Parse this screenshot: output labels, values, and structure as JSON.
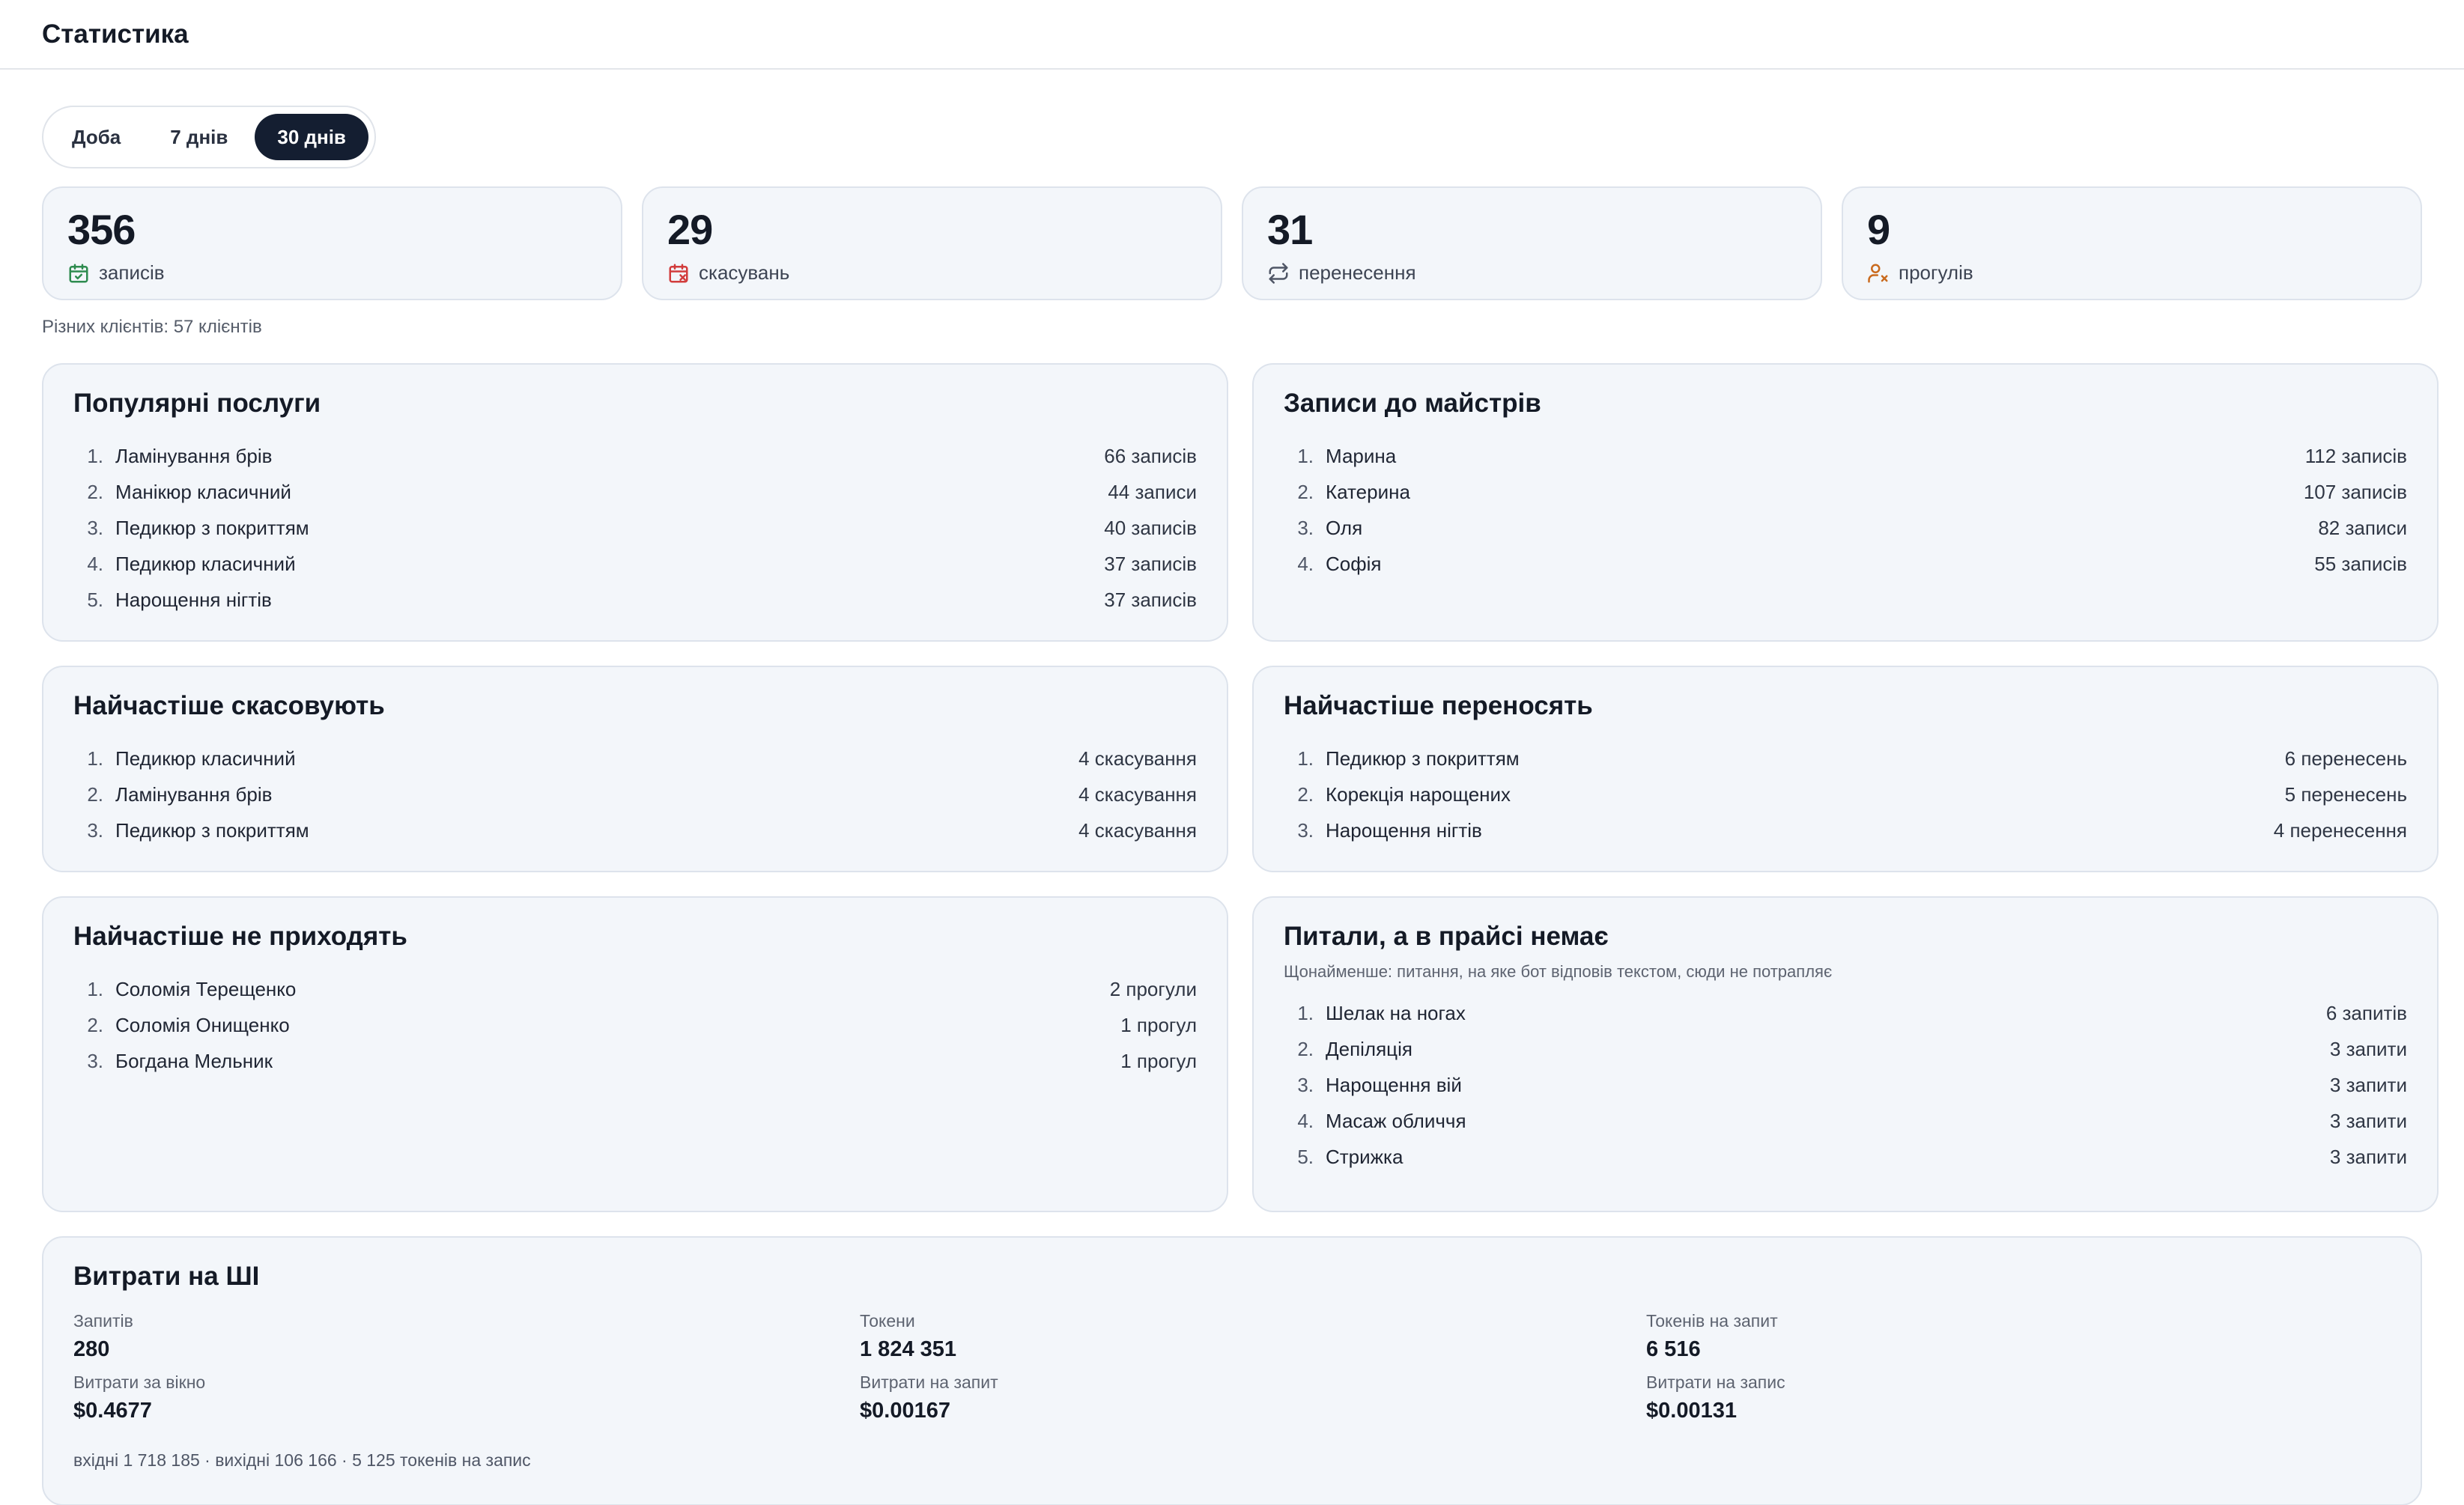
{
  "page_title": "Статистика",
  "periods": [
    {
      "label": "Доба",
      "active": false
    },
    {
      "label": "7 днів",
      "active": false
    },
    {
      "label": "30 днів",
      "active": true
    }
  ],
  "stats": [
    {
      "value": "356",
      "label": "записів",
      "icon": "calendar-check-icon",
      "color": "#2e8b4f"
    },
    {
      "value": "29",
      "label": "скасувань",
      "icon": "calendar-x-icon",
      "color": "#d23c3c"
    },
    {
      "value": "31",
      "label": "перенесення",
      "icon": "repeat-icon",
      "color": "#4f5666"
    },
    {
      "value": "9",
      "label": "прогулів",
      "icon": "user-x-icon",
      "color": "#c96a1e"
    }
  ],
  "clients_text": "Різних клієнтів: 57 клієнтів",
  "popular": {
    "title": "Популярні послуги",
    "items": [
      {
        "n": "1.",
        "name": "Ламінування брів",
        "value": "66 записів"
      },
      {
        "n": "2.",
        "name": "Манікюр класичний",
        "value": "44 записи"
      },
      {
        "n": "3.",
        "name": "Педикюр з покриттям",
        "value": "40 записів"
      },
      {
        "n": "4.",
        "name": "Педикюр класичний",
        "value": "37 записів"
      },
      {
        "n": "5.",
        "name": "Нарощення нігтів",
        "value": "37 записів"
      }
    ]
  },
  "masters": {
    "title": "Записи до майстрів",
    "items": [
      {
        "n": "1.",
        "name": "Марина",
        "value": "112 записів"
      },
      {
        "n": "2.",
        "name": "Катерина",
        "value": "107 записів"
      },
      {
        "n": "3.",
        "name": "Оля",
        "value": "82 записи"
      },
      {
        "n": "4.",
        "name": "Софія",
        "value": "55 записів"
      }
    ]
  },
  "cancels": {
    "title": "Найчастіше скасовують",
    "items": [
      {
        "n": "1.",
        "name": "Педикюр класичний",
        "value": "4 скасування"
      },
      {
        "n": "2.",
        "name": "Ламінування брів",
        "value": "4 скасування"
      },
      {
        "n": "3.",
        "name": "Педикюр з покриттям",
        "value": "4 скасування"
      }
    ]
  },
  "reschedules": {
    "title": "Найчастіше переносять",
    "items": [
      {
        "n": "1.",
        "name": "Педикюр з покриттям",
        "value": "6 перенесень"
      },
      {
        "n": "2.",
        "name": "Корекція нарощених",
        "value": "5 перенесень"
      },
      {
        "n": "3.",
        "name": "Нарощення нігтів",
        "value": "4 перенесення"
      }
    ]
  },
  "noshows": {
    "title": "Найчастіше не приходять",
    "items": [
      {
        "n": "1.",
        "name": "Соломія Терещенко",
        "value": "2 прогули"
      },
      {
        "n": "2.",
        "name": "Соломія Онищенко",
        "value": "1 прогул"
      },
      {
        "n": "3.",
        "name": "Богдана Мельник",
        "value": "1 прогул"
      }
    ]
  },
  "asked": {
    "title": "Питали, а в прайсі немає",
    "hint": "Щонайменше: питання, на яке бот відповів текстом, сюди не потрапляє",
    "items": [
      {
        "n": "1.",
        "name": "Шелак на ногах",
        "value": "6 запитів"
      },
      {
        "n": "2.",
        "name": "Депіляція",
        "value": "3 запити"
      },
      {
        "n": "3.",
        "name": "Нарощення вій",
        "value": "3 запити"
      },
      {
        "n": "4.",
        "name": "Масаж обличчя",
        "value": "3 запити"
      },
      {
        "n": "5.",
        "name": "Стрижка",
        "value": "3 запити"
      }
    ]
  },
  "ai": {
    "title": "Витрати на ШІ",
    "metrics": [
      {
        "label": "Запитів",
        "value": "280"
      },
      {
        "label": "Токени",
        "value": "1 824 351"
      },
      {
        "label": "Токенів на запит",
        "value": "6 516"
      },
      {
        "label": "Витрати за вікно",
        "value": "$0.4677"
      },
      {
        "label": "Витрати на запит",
        "value": "$0.00167"
      },
      {
        "label": "Витрати на запис",
        "value": "$0.00131"
      }
    ],
    "footer": "вхідні 1 718 185 · вихідні 106 166 · 5 125 токенів на запис"
  }
}
